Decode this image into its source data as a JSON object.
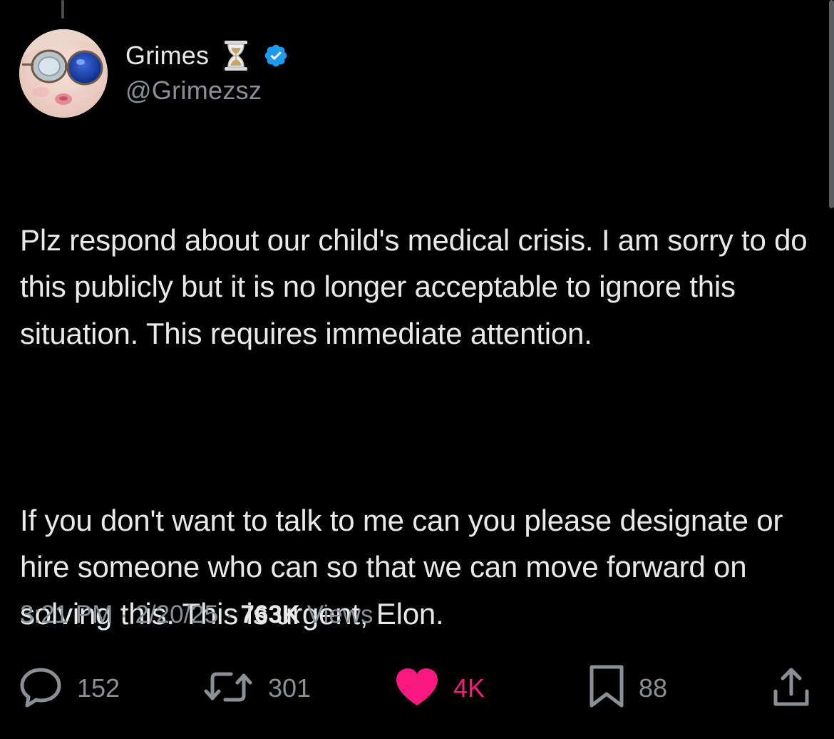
{
  "tweet": {
    "author": {
      "display_name": "Grimes",
      "name_emoji": "hourglass-emoji",
      "verified_icon": "verified-badge-icon",
      "handle": "@Grimezsz"
    },
    "body_paragraphs": [
      "Plz respond about our child's medical crisis.  I am sorry to do this publicly but it is no longer acceptable to ignore this situation.  This requires immediate attention.",
      "If you don't want to talk to me can you please designate or hire someone who can so that we can move forward on solving this.   This is urgent, Elon."
    ],
    "meta": {
      "time": "3:21 PM",
      "separator": "·",
      "date": "2/20/25",
      "views_count": "763K",
      "views_label": "Views"
    },
    "actions": {
      "reply": {
        "icon": "reply-icon",
        "count": "152"
      },
      "repost": {
        "icon": "repost-icon",
        "count": "301"
      },
      "like": {
        "icon": "heart-icon",
        "count": "4K",
        "liked": true
      },
      "bookmark": {
        "icon": "bookmark-icon",
        "count": "88"
      },
      "share": {
        "icon": "share-icon"
      }
    }
  },
  "colors": {
    "background": "#000000",
    "text_primary": "#e7e9ea",
    "text_secondary": "#8b9096",
    "like_pink": "#f91880",
    "verified_blue": "#1d9bf0"
  }
}
